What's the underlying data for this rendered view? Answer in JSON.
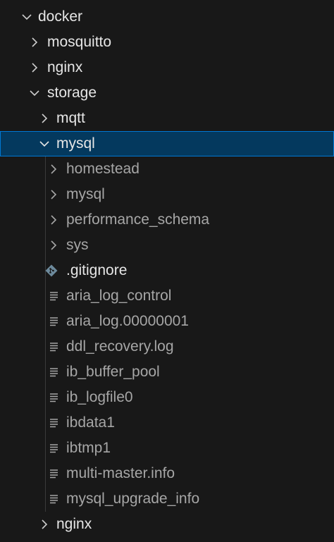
{
  "explorer": {
    "rows": [
      {
        "label": "docker"
      },
      {
        "label": "mosquitto"
      },
      {
        "label": "nginx"
      },
      {
        "label": "storage"
      },
      {
        "label": "mqtt"
      },
      {
        "label": "mysql"
      },
      {
        "label": "homestead"
      },
      {
        "label": "mysql"
      },
      {
        "label": "performance_schema"
      },
      {
        "label": "sys"
      },
      {
        "label": ".gitignore"
      },
      {
        "label": "aria_log_control"
      },
      {
        "label": "aria_log.00000001"
      },
      {
        "label": "ddl_recovery.log"
      },
      {
        "label": "ib_buffer_pool"
      },
      {
        "label": "ib_logfile0"
      },
      {
        "label": "ibdata1"
      },
      {
        "label": "ibtmp1"
      },
      {
        "label": "multi-master.info"
      },
      {
        "label": "mysql_upgrade_info"
      },
      {
        "label": "nginx"
      }
    ],
    "colors": {
      "background": "#181818",
      "selected_background": "#04395e",
      "selected_border": "#0078d4",
      "git_icon": "#6d8a9c"
    }
  }
}
